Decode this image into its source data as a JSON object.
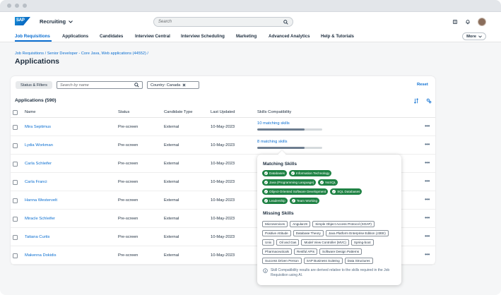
{
  "shell": {
    "logo": "SAP",
    "app_title": "Recruiting",
    "search_placeholder": "Search"
  },
  "nav": {
    "items": [
      {
        "label": "Job Requisitions",
        "active": true
      },
      {
        "label": "Applications"
      },
      {
        "label": "Candidates"
      },
      {
        "label": "Interview Central"
      },
      {
        "label": "Interview Scheduling"
      },
      {
        "label": "Marketing"
      },
      {
        "label": "Advanced Analytics"
      },
      {
        "label": "Help & Tutorials"
      }
    ],
    "more_label": "More"
  },
  "header": {
    "breadcrumb": "Job Requisitions / Senior Developer - Core Java, Web applications (44552) /",
    "title": "Applications"
  },
  "toolbar": {
    "filters_label": "Status & Filters",
    "name_search_placeholder": "Search by name",
    "country_token": "Country: Canada",
    "reset_label": "Reset"
  },
  "table": {
    "title": "Applications (590)",
    "columns": [
      "Name",
      "Status",
      "Candidate Type",
      "Last Updated",
      "Skills Compatibility"
    ],
    "rows": [
      {
        "name": "Mira Septimus",
        "status": "Pre-screen",
        "type": "External",
        "updated": "10-May-2023",
        "skills": "10 matching skills",
        "skill_level": 0.73
      },
      {
        "name": "Lydia Workman",
        "status": "Pre-screen",
        "type": "External",
        "updated": "10-May-2023",
        "skills": "8 matching skills",
        "skill_level": 0.73
      },
      {
        "name": "Carla Schleifer",
        "status": "Pre-screen",
        "type": "External",
        "updated": "10-May-2023",
        "skills": "",
        "skill_level": null
      },
      {
        "name": "Carla Franci",
        "status": "Pre-screen",
        "type": "External",
        "updated": "10-May-2023",
        "skills": "",
        "skill_level": null
      },
      {
        "name": "Hanna Westervelt",
        "status": "Pre-screen",
        "type": "External",
        "updated": "10-May-2023",
        "skills": "",
        "skill_level": null
      },
      {
        "name": "Miracle Schleifer",
        "status": "Pre-screen",
        "type": "External",
        "updated": "10-May-2023",
        "skills": "",
        "skill_level": null
      },
      {
        "name": "Tatiana Curtis",
        "status": "Pre-screen",
        "type": "External",
        "updated": "10-May-2023",
        "skills": "",
        "skill_level": null
      },
      {
        "name": "Makenna Dokidis",
        "status": "Pre-screen",
        "type": "External",
        "updated": "10-May-2023",
        "skills": "",
        "skill_level": null
      }
    ]
  },
  "popover": {
    "matching_title": "Matching Skills",
    "matching_rows": [
      [
        "Databases",
        "Information Technology"
      ],
      [
        "Java (Programming Language)",
        "NoSQL"
      ],
      [
        "Object-Oriented Software Development",
        "SQL Databases"
      ],
      [
        "Leadership",
        "Team Working"
      ]
    ],
    "missing_title": "Missing Skills",
    "missing_rows": [
      [
        "Microservices",
        "AngularJS",
        "Simple Object Access Protocol (SOAP)"
      ],
      [
        "Positive Attitude",
        "Database Theory",
        "Java Platform Enterprise Edition (J2EE)"
      ],
      [
        "Unix",
        "Oil and Gas",
        "Model View Controller (MVC)",
        "Spring-boot"
      ],
      [
        "Pharmaceuticals",
        "Restful APIs",
        "Software Design Patterns"
      ],
      [
        "Success Driven Person",
        "SAP Business Suiteing",
        "Data Structures"
      ]
    ],
    "note": "Skill Compatibility results are derived relative to the skills required in the Job Requisition using AI."
  },
  "colors": {
    "accent": "#0a6ed1",
    "match_chip": "#1f8244",
    "bar_fill": "#6d7d8f"
  }
}
